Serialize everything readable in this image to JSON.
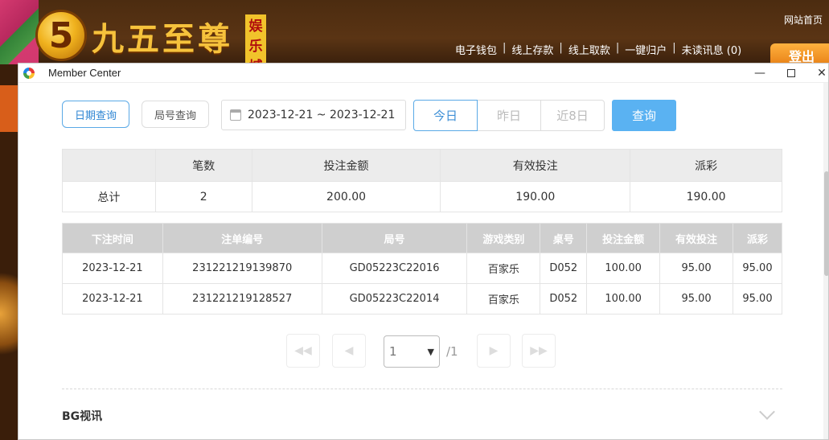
{
  "site": {
    "logo_numeral": "5",
    "logo_text": "九五至尊",
    "logo_badge": [
      "娱",
      "乐",
      "城"
    ],
    "top_link": "网站首页",
    "nav": [
      "电子钱包",
      "线上存款",
      "线上取款",
      "一键归户",
      "未读讯息 (0)"
    ],
    "logout": "登出"
  },
  "window": {
    "title": "Member Center",
    "min": "—",
    "close": "✕"
  },
  "filters": {
    "tab_date": "日期查询",
    "tab_round": "局号查询",
    "date_range": "2023-12-21 ~ 2023-12-21",
    "today": "今日",
    "yesterday": "昨日",
    "last8": "近8日",
    "query": "查询"
  },
  "summary": {
    "headers": [
      "",
      "笔数",
      "投注金额",
      "有效投注",
      "派彩"
    ],
    "row": [
      "总计",
      "2",
      "200.00",
      "190.00",
      "190.00"
    ]
  },
  "detail": {
    "headers": [
      "下注时间",
      "注单编号",
      "局号",
      "游戏类别",
      "桌号",
      "投注金额",
      "有效投注",
      "派彩"
    ],
    "rows": [
      [
        "2023-12-21",
        "231221219139870",
        "GD05223C22016",
        "百家乐",
        "D052",
        "100.00",
        "95.00",
        "95.00"
      ],
      [
        "2023-12-21",
        "231221219128527",
        "GD05223C22014",
        "百家乐",
        "D052",
        "100.00",
        "95.00",
        "95.00"
      ]
    ]
  },
  "pager": {
    "first": "◀◀",
    "prev": "◀",
    "next": "▶",
    "last": "▶▶",
    "current": "1",
    "total": "/1"
  },
  "section": {
    "title": "BG视讯"
  }
}
